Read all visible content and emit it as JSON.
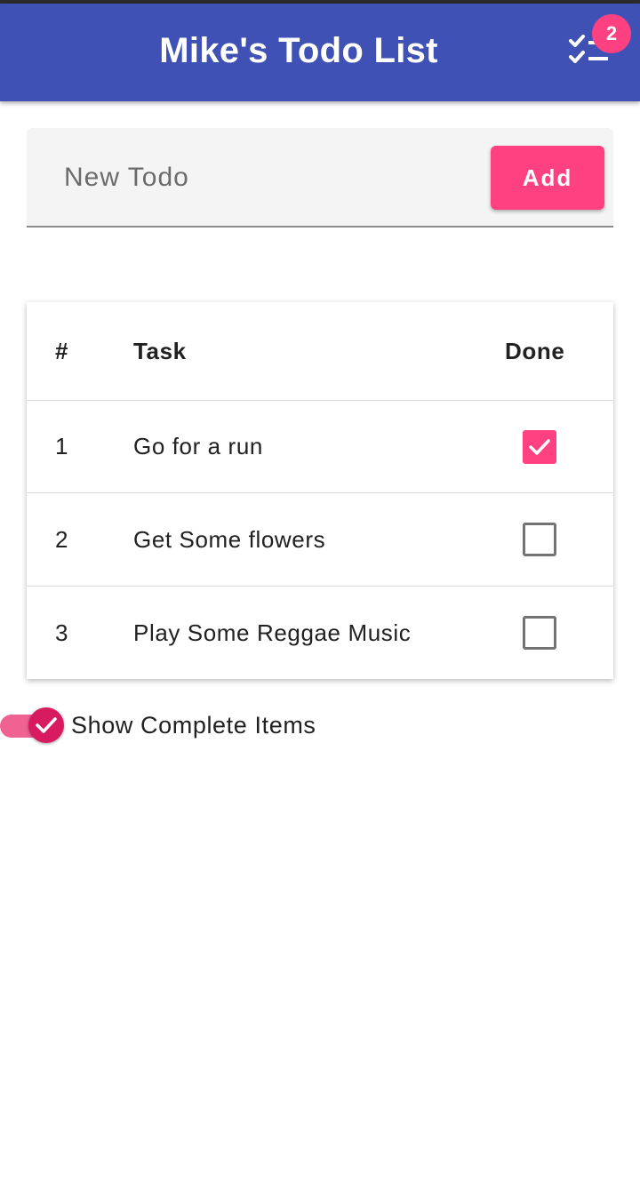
{
  "app_bar": {
    "title": "Mike's Todo List",
    "checklist_icon": "checklist-icon",
    "badge_count": "2",
    "color": "#3f51b5"
  },
  "new_todo": {
    "placeholder": "New Todo",
    "value": "",
    "add_label": "Add",
    "accent": "#ff4081"
  },
  "table": {
    "headers": [
      "#",
      "Task",
      "Done"
    ],
    "rows": [
      {
        "num": "1",
        "task": "Go for a run",
        "done": true
      },
      {
        "num": "2",
        "task": "Get Some flowers",
        "done": false
      },
      {
        "num": "3",
        "task": "Play Some Reggae Music",
        "done": false
      }
    ]
  },
  "show_complete": {
    "label": "Show Complete Items",
    "enabled": true
  }
}
